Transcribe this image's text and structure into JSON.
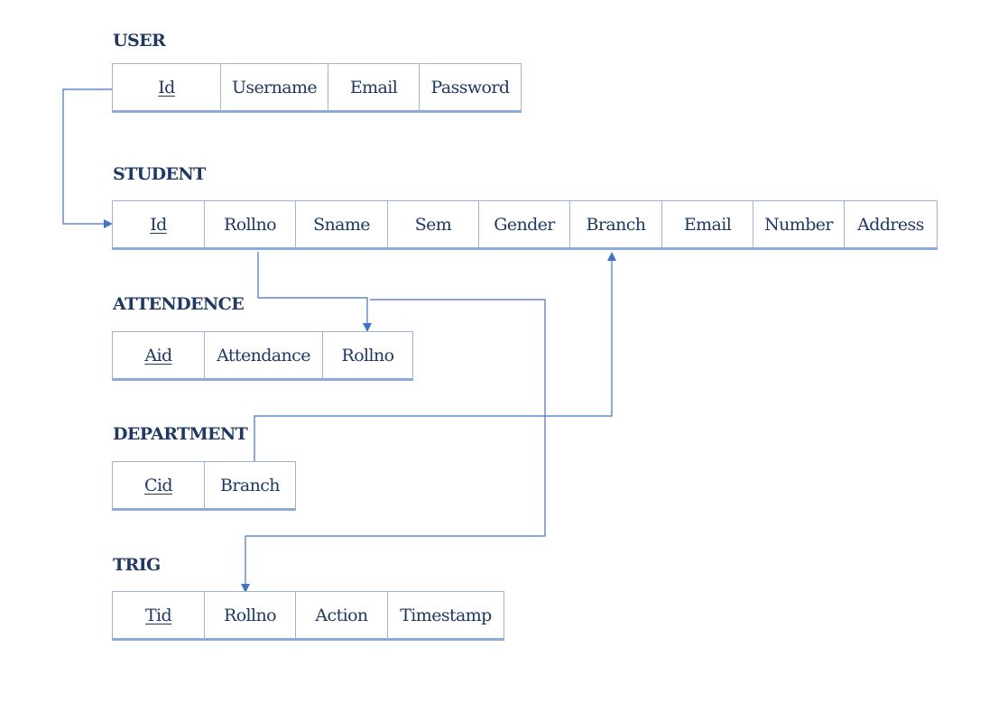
{
  "tables": {
    "user": {
      "title": "USER",
      "columns": [
        "Id",
        "Username",
        "Email",
        "Password"
      ]
    },
    "student": {
      "title": "STUDENT",
      "columns": [
        "Id",
        "Rollno",
        "Sname",
        "Sem",
        "Gender",
        "Branch",
        "Email",
        "Number",
        "Address"
      ]
    },
    "attendence": {
      "title": "ATTENDENCE",
      "columns": [
        "Aid",
        "Attendance",
        "Rollno"
      ]
    },
    "department": {
      "title": "DEPARTMENT",
      "columns": [
        "Cid",
        "Branch"
      ]
    },
    "trig": {
      "title": "TRIG",
      "columns": [
        "Tid",
        "Rollno",
        "Action",
        "Timestamp"
      ]
    }
  },
  "relations": [
    {
      "from": "USER.Id",
      "to": "STUDENT.Id"
    },
    {
      "from": "STUDENT.Rollno",
      "to": "ATTENDENCE.Rollno"
    },
    {
      "from": "DEPARTMENT.Branch",
      "to": "STUDENT.Branch"
    },
    {
      "from": "STUDENT.Rollno",
      "to": "TRIG.Rollno"
    }
  ],
  "colors": {
    "text": "#1f3864",
    "line": "#4472c4",
    "border": "#9fb3d9",
    "underline": "#8eaadb"
  }
}
